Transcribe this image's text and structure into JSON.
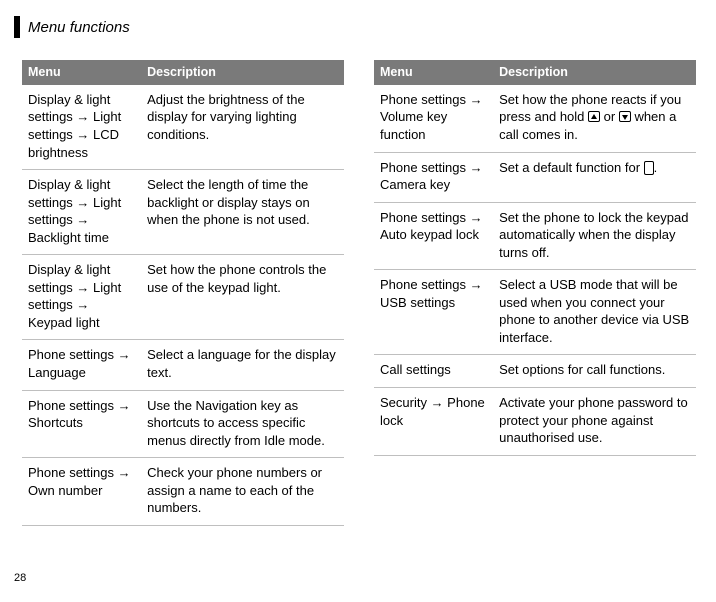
{
  "header": {
    "title": "Menu functions"
  },
  "page_number": "28",
  "tables": {
    "left": {
      "headers": [
        "Menu",
        "Description"
      ],
      "rows": [
        {
          "menu": "Display & light settings → Light settings → LCD brightness",
          "desc": "Adjust the brightness of the display for varying lighting conditions."
        },
        {
          "menu": "Display & light settings → Light settings → Backlight time",
          "desc": "Select the length of time the backlight or display stays on when the phone is not used."
        },
        {
          "menu": "Display & light settings → Light settings → Keypad light",
          "desc": "Set how the phone controls the use of the keypad light."
        },
        {
          "menu": "Phone settings → Language",
          "desc": "Select a language for the display text."
        },
        {
          "menu": "Phone settings → Shortcuts",
          "desc": "Use the Navigation key as shortcuts to access specific menus directly from Idle mode."
        },
        {
          "menu": "Phone settings → Own number",
          "desc": "Check your phone numbers or assign a name to each of the numbers."
        }
      ]
    },
    "right": {
      "headers": [
        "Menu",
        "Description"
      ],
      "rows": [
        {
          "menu": "Phone settings → Volume key function",
          "desc_pre": "Set how the phone reacts if you press and hold ",
          "desc_mid": " or ",
          "desc_post": " when a call comes in."
        },
        {
          "menu": "Phone settings → Camera key",
          "desc_pre": "Set a default function for ",
          "desc_post": "."
        },
        {
          "menu": "Phone settings → Auto keypad lock",
          "desc": "Set the phone to lock the keypad automatically when the display turns off."
        },
        {
          "menu": "Phone settings → USB settings",
          "desc": "Select a USB mode that will be used when you connect your phone to another device via USB interface."
        },
        {
          "menu": "Call settings",
          "desc": "Set options for call functions."
        },
        {
          "menu": "Security → Phone lock",
          "desc": "Activate your phone password to protect your phone against unauthorised use."
        }
      ]
    }
  }
}
